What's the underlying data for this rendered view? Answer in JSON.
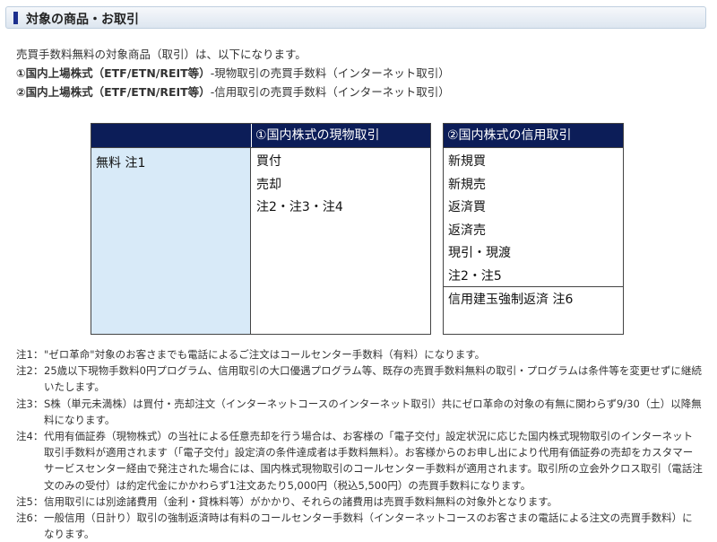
{
  "header": {
    "title": "対象の商品・お取引"
  },
  "intro": {
    "line1": "売買手数料無料の対象商品（取引）は、以下になります。",
    "line2_bold": "①国内上場株式（ETF/ETN/REIT等）",
    "line2_rest": "-現物取引の売買手数料（インターネット取引）",
    "line3_bold": "②国内上場株式（ETF/ETN/REIT等）",
    "line3_rest": "-信用取引の売買手数料（インターネット取引）"
  },
  "table_genbutsu": {
    "header": "①国内株式の現物取引",
    "left_label": "無料 注1",
    "items": [
      "買付",
      "売却",
      "注2・注3・注4"
    ]
  },
  "table_shinyo": {
    "header": "②国内株式の信用取引",
    "items": [
      "新規買",
      "新規売",
      "返済買",
      "返済売",
      "現引・現渡",
      "注2・注5"
    ],
    "bottom": "信用建玉強制返済 注6"
  },
  "notes": [
    {
      "label": "注1：",
      "text": "\"ゼロ革命\"対象のお客さまでも電話によるご注文はコールセンター手数料（有料）になります。"
    },
    {
      "label": "注2：",
      "text": "25歳以下現物手数料0円プログラム、信用取引の大口優遇プログラム等、既存の売買手数料無料の取引・プログラムは条件等を変更せずに継続いたします。"
    },
    {
      "label": "注3：",
      "text": "S株（単元未満株）は買付・売却注文（インターネットコースのインターネット取引）共にゼロ革命の対象の有無に関わらず9/30（土）以降無料になります。"
    },
    {
      "label": "注4：",
      "text": "代用有価証券（現物株式）の当社による任意売却を行う場合は、お客様の「電子交付」設定状況に応じた国内株式現物取引のインターネット取引手数料が適用されます（「電子交付」設定済の条件達成者は手数料無料）。お客様からのお申し出により代用有価証券の売却をカスタマーサービスセンター経由で発注された場合には、国内株式現物取引のコールセンター手数料が適用されます。取引所の立会外クロス取引（電話注文のみの受付）は約定代金にかかわらず1注文あたり5,000円（税込5,500円）の売買手数料になります。"
    },
    {
      "label": "注5：",
      "text": "信用取引には別途諸費用（金利・貸株料等）がかかり、それらの諸費用は売買手数料無料の対象外となります。"
    },
    {
      "label": "注6：",
      "text": "一般信用（日計り）取引の強制返済時は有料のコールセンター手数料（インターネットコースのお客さまの電話による注文の売買手数料）になります。"
    }
  ]
}
